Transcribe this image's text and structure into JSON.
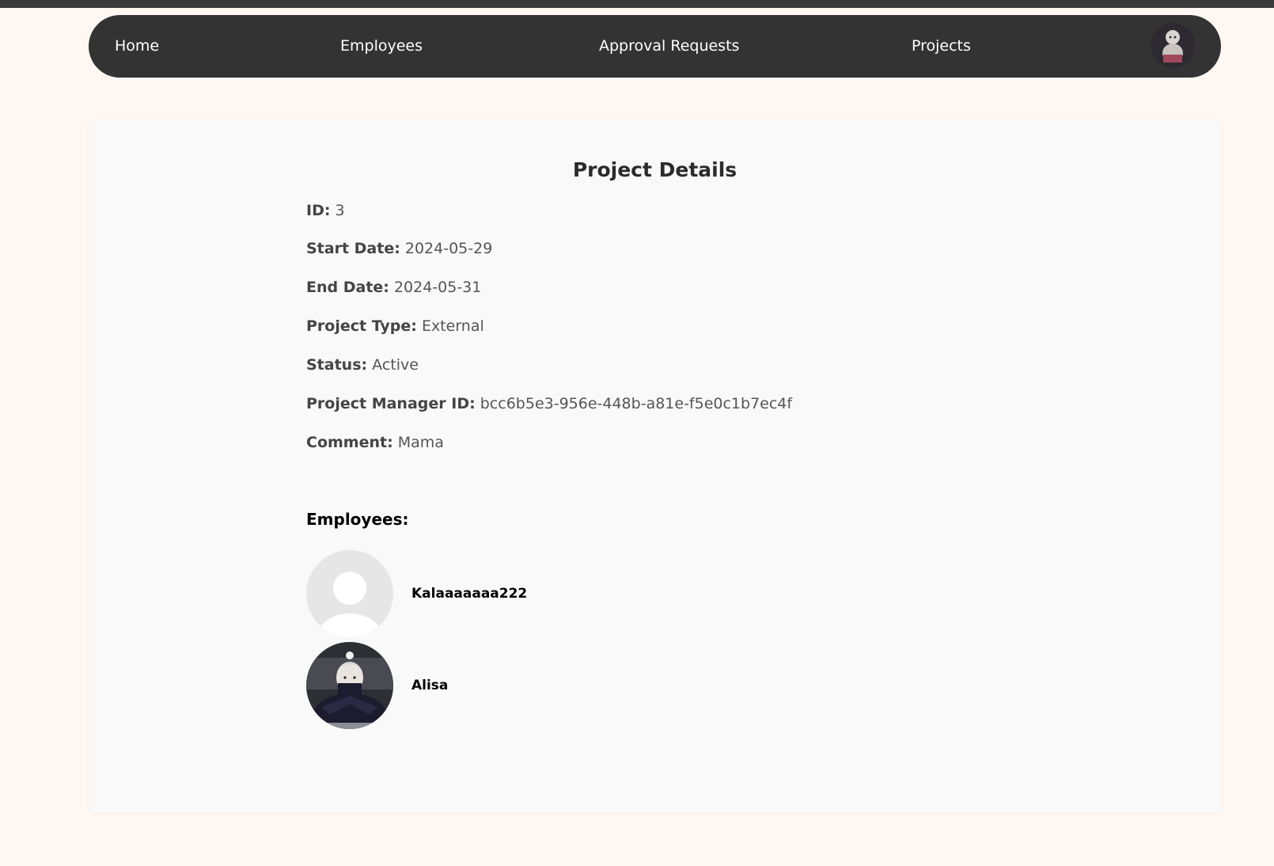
{
  "nav": {
    "home": "Home",
    "employees": "Employees",
    "approval_requests": "Approval Requests",
    "projects": "Projects",
    "avatar_icon": "user-avatar-icon"
  },
  "project": {
    "title": "Project Details",
    "fields": [
      {
        "label": "ID:",
        "value": "3"
      },
      {
        "label": "Start Date:",
        "value": "2024-05-29"
      },
      {
        "label": "End Date:",
        "value": "2024-05-31"
      },
      {
        "label": "Project Type:",
        "value": "External"
      },
      {
        "label": "Status:",
        "value": "Active"
      },
      {
        "label": "Project Manager ID:",
        "value": "bcc6b5e3-956e-448b-a81e-f5e0c1b7ec4f"
      },
      {
        "label": "Comment:",
        "value": "Mama"
      }
    ]
  },
  "employees": {
    "heading": "Employees:",
    "items": [
      {
        "name": "Kalaaaaaaa222",
        "avatar": "default-avatar-icon"
      },
      {
        "name": "Alisa",
        "avatar": "anime-character-avatar"
      }
    ]
  },
  "colors": {
    "page_bg": "#fff7f1",
    "navbar_bg": "#333333",
    "card_bg": "#f9f9f9",
    "text": "#555555"
  }
}
